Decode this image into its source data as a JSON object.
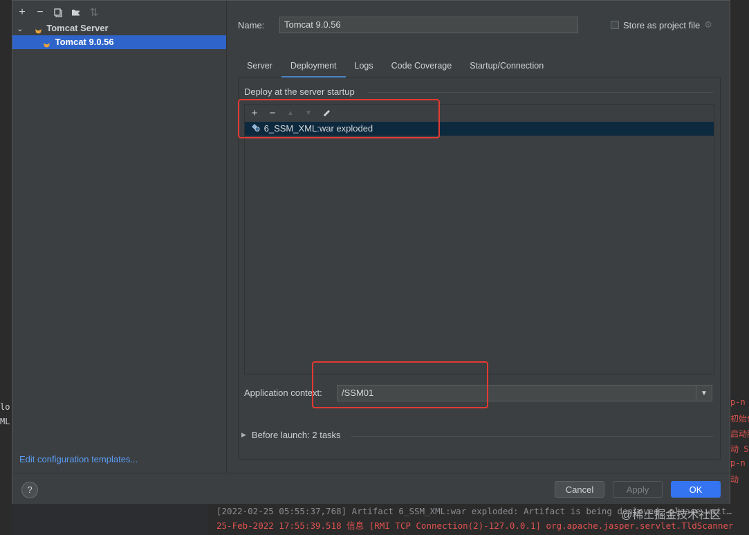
{
  "colors": {
    "accent": "#2f65ca",
    "ok_button": "#3574f0",
    "annotation": "#e33a32",
    "link": "#589df6"
  },
  "left_panel": {
    "toolbar": [
      {
        "icon": "plus-icon",
        "glyph": "+"
      },
      {
        "icon": "minus-icon",
        "glyph": "−"
      },
      {
        "icon": "copy-icon",
        "glyph": "⧉"
      },
      {
        "icon": "folder-add-icon",
        "glyph": "▆"
      },
      {
        "icon": "sort-icon",
        "glyph": "⇅"
      }
    ],
    "tree": {
      "group_label": "Tomcat Server",
      "item_label": "Tomcat 9.0.56"
    },
    "edit_templates_link": "Edit configuration templates..."
  },
  "form": {
    "name_label": "Name:",
    "name_value": "Tomcat 9.0.56",
    "store_label": "Store as project file"
  },
  "tabs": [
    {
      "label": "Server"
    },
    {
      "label": "Deployment",
      "active": true
    },
    {
      "label": "Logs"
    },
    {
      "label": "Code Coverage"
    },
    {
      "label": "Startup/Connection"
    }
  ],
  "deployment": {
    "section_title": "Deploy at the server startup",
    "artifact": "6_SSM_XML:war exploded",
    "app_context_label": "Application context:",
    "app_context_value": "/SSM01",
    "before_launch": "Before launch: 2 tasks"
  },
  "footer": {
    "help": "?",
    "cancel": "Cancel",
    "apply": "Apply",
    "ok": "OK"
  },
  "background": {
    "console_line_1": "[2022-02-25 05:55:37,768] Artifact 6_SSM_XML:war exploded: Artifact is being deployed, please wait…",
    "console_line_2": "25-Feb-2022 17:55:39.518 信息 [RMI TCP Connection(2)-127.0.0.1] org.apache.jasper.servlet.TldScanner",
    "left_frag_1": "lo",
    "left_frag_2": "ML:",
    "right_frags": [
      "p-n",
      "初始化",
      "启动服",
      "动 S",
      "p-n",
      "动"
    ],
    "watermark": "@稀土掘金技术社区"
  }
}
